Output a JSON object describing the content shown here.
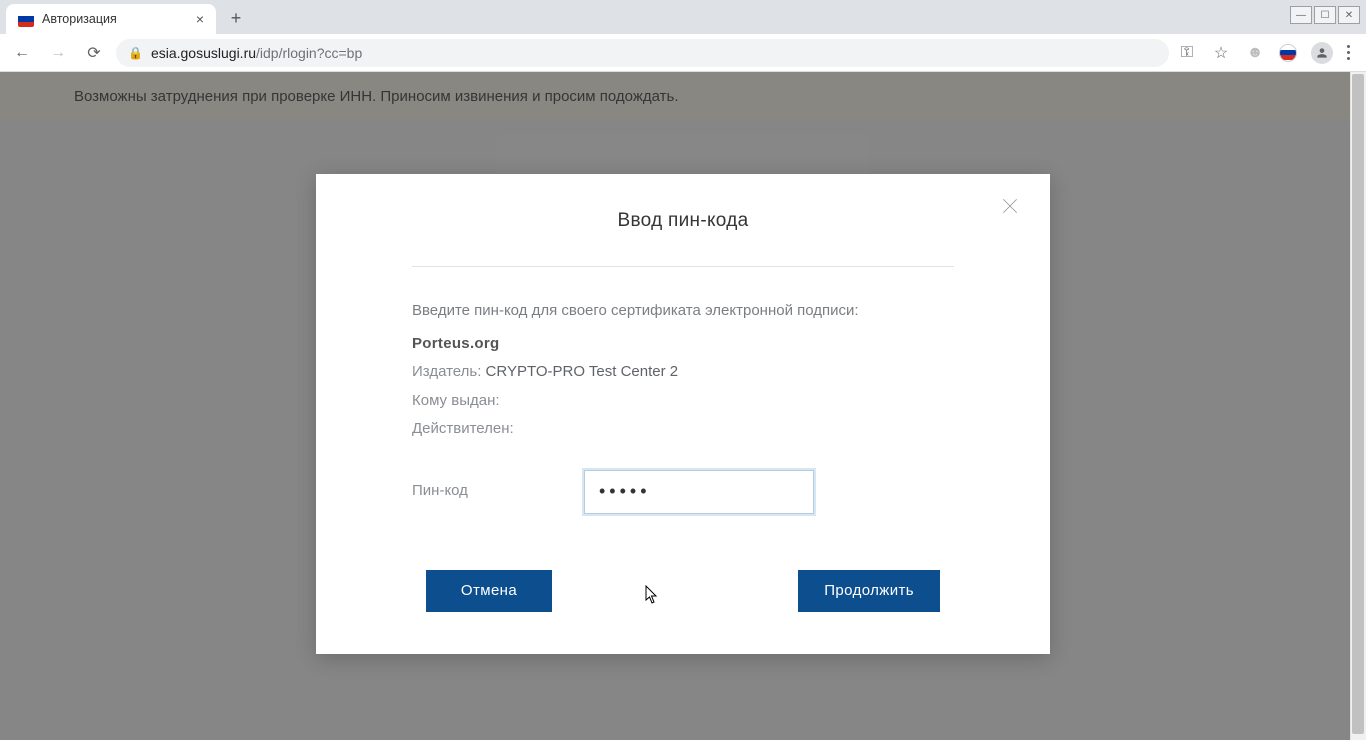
{
  "browser": {
    "tab_title": "Авторизация",
    "url_host": "esia.gosuslugi.ru",
    "url_path": "/idp/rlogin?cc=bp"
  },
  "page": {
    "notice": "Возможны затруднения при проверке ИНН. Приносим извинения и просим подождать."
  },
  "modal": {
    "title": "Ввод пин-кода",
    "prompt": "Введите пин-код для своего сертификата электронной подписи:",
    "cert_name": "Porteus.org",
    "issuer_label": "Издатель:",
    "issuer_value": "CRYPTO-PRO Test Center 2",
    "subject_label": "Кому выдан:",
    "subject_value": "",
    "valid_label": "Действителен:",
    "valid_value": "",
    "pin_label": "Пин-код",
    "pin_value": "•••••",
    "cancel": "Отмена",
    "continue": "Продолжить"
  }
}
